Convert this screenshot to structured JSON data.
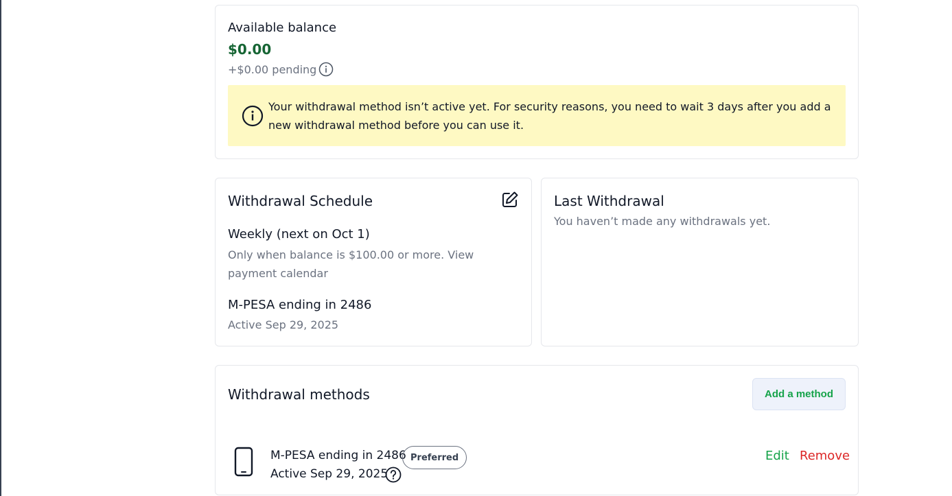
{
  "balance": {
    "label": "Available balance",
    "amount": "$0.00",
    "pending": "+$0.00 pending",
    "notice": "Your withdrawal method isn’t active yet. For security reasons, you need to wait 3 days after you add a new withdrawal method before you can use it."
  },
  "schedule": {
    "title": "Withdrawal Schedule",
    "frequency": "Weekly (next on Oct 1)",
    "condition": "Only when balance is $100.00 or more. View payment calendar",
    "method": "M-PESA ending in 2486",
    "method_status": "Active Sep 29, 2025"
  },
  "last_withdrawal": {
    "title": "Last Withdrawal",
    "message": "You haven’t made any withdrawals yet."
  },
  "methods": {
    "title": "Withdrawal methods",
    "add_label": "Add a method",
    "items": [
      {
        "name": "M-PESA ending in 2486",
        "badge": "Preferred",
        "status": "Active Sep 29, 2025",
        "edit_label": "Edit",
        "remove_label": "Remove",
        "icon": "phone-icon"
      }
    ]
  },
  "colors": {
    "amount": "#166534",
    "notice_bg": "#fef9c3",
    "link_green": "#16a34a",
    "link_red": "#dc2626"
  }
}
